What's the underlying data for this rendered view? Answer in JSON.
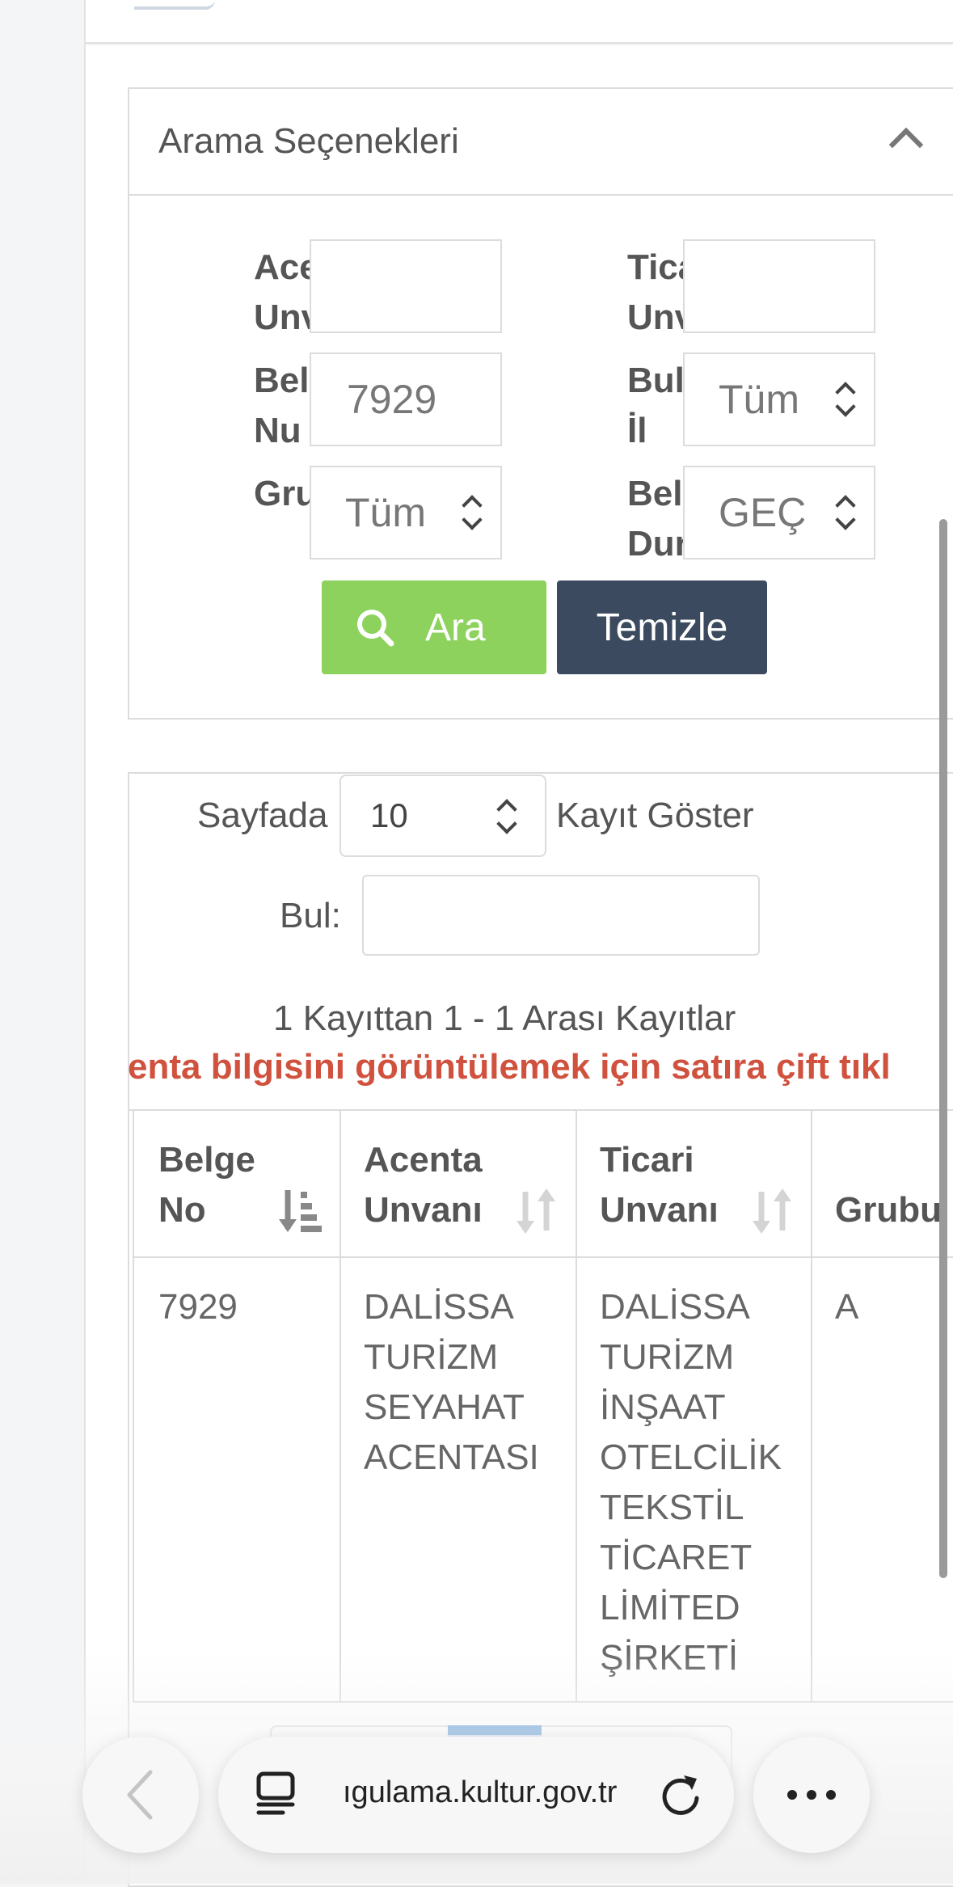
{
  "search_panel": {
    "title": "Arama Seçenekleri",
    "fields": {
      "acenta_label": "Ace\nUnv",
      "ticari_label": "Tica\nUnv",
      "belge_label": "Bel\nNu",
      "belge_value": "7929",
      "bul_il_label": "Bul\nİl",
      "bul_il_value": "Tüm",
      "grup_label": "Gru",
      "grup_value": "Tüm",
      "durum_label": "Bel\nDur",
      "durum_value": "GEÇİ"
    },
    "search_button": "Ara",
    "clear_button": "Temizle"
  },
  "table_controls": {
    "per_page_prefix": "Sayfada",
    "per_page_value": "10",
    "per_page_suffix": "Kayıt Göster",
    "find_label": "Bul:",
    "count_text": "1 Kayıttan 1 - 1 Arası Kayıtlar",
    "hint_text": "enta bilgisini görüntülemek için satıra çift tıkl"
  },
  "table": {
    "headers": [
      "Belge\nNo",
      "Acenta\nUnvanı",
      "Ticari\nUnvanı",
      "Grubu"
    ],
    "rows": [
      [
        "7929",
        "DALİSSA\nTURİZM\nSEYAHAT\nACENTASI",
        "DALİSSA\nTURİZM\nİNŞAAT\nOTELCİLİK\nTEKSTİL\nTİCARET\nLİMİTED\nŞİRKETİ",
        "A"
      ]
    ]
  },
  "browser": {
    "url": "ıgulama.kultur.gov.tr"
  },
  "icons": [
    "chevron-up-icon",
    "search-icon",
    "select-arrows-icon",
    "sort-desc-icon",
    "sort-icon",
    "back-arrow-icon",
    "tabs-icon",
    "reload-icon",
    "more-icon"
  ],
  "colors": {
    "search_button": "#8cd25c",
    "clear_button": "#3b4a5e",
    "hint": "#d0523e"
  }
}
